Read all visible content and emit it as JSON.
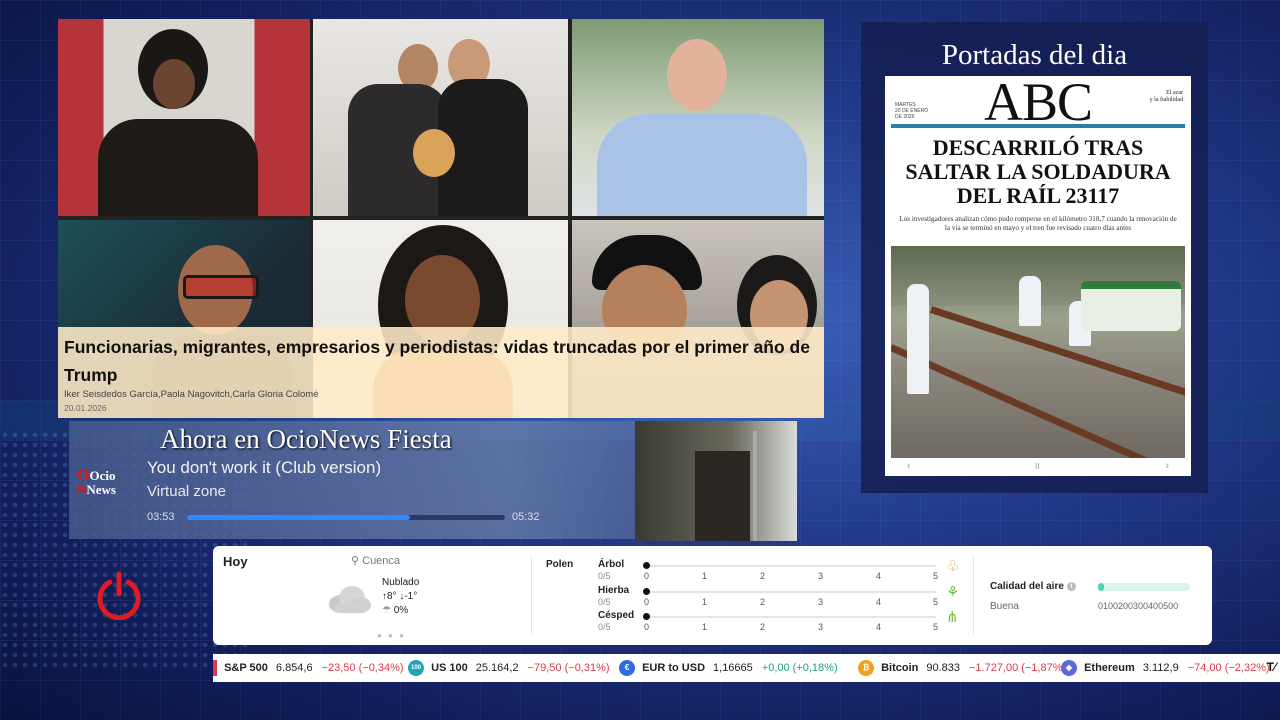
{
  "news": {
    "title": "Funcionarias, migrantes, empresarios y periodistas: vidas truncadas por el primer año de Trump",
    "authors": "Iker Seisdedos García,Paola Nagovitch,Carla Gloria Colomé",
    "date": "20.01.2026"
  },
  "now_playing": {
    "heading": "Ahora en OcioNews Fiesta",
    "song": "You don't work it (Club version)",
    "artist": "Virtual zone",
    "elapsed": "03:53",
    "total": "05:32",
    "progress": 0.7,
    "logo_lines": [
      "Ocio",
      "News"
    ]
  },
  "front_pages": {
    "heading": "Portadas del dia",
    "masthead": "ABC",
    "date_line": [
      "MARTES",
      "20 DE ENERO",
      "DE 2026"
    ],
    "tagline": [
      "El azar",
      "y la fiabilidad"
    ],
    "headline": "DESCARRILÓ TRAS SALTAR LA SOLDADURA DEL RAÍL 23117",
    "subheadline": "Los investigadores analizan cómo pudo romperse en el kilómetro 318,7 cuando la renovación de la vía se terminó en mayo y el tren fue revisado cuatro días antes",
    "prev": "‹",
    "pause": "II",
    "next": "›"
  },
  "weather": {
    "day": "Hoy",
    "location": "Cuenca",
    "condition": "Nublado",
    "temps": "↑8°  ↓-1°",
    "precip": "0%",
    "pager": "● ● ●",
    "pollen_label": "Polen",
    "pollen": [
      {
        "name": "Árbol",
        "value": "0/5",
        "icon": "tree-icon"
      },
      {
        "name": "Hierba",
        "value": "0/5",
        "icon": "herb-icon"
      },
      {
        "name": "Césped",
        "value": "0/5",
        "icon": "grass-icon"
      }
    ],
    "scale": [
      "0",
      "1",
      "2",
      "3",
      "4",
      "5"
    ],
    "air_quality_label": "Calidad del aire",
    "air_quality_value": "Buena",
    "air_scale": "0100200300400500"
  },
  "ticker": [
    {
      "name": "S&P 500",
      "price": "6.854,6",
      "change": "−23,50 (−0,34%)",
      "dir": "down",
      "icon_text": "",
      "color": "#e0394a"
    },
    {
      "name": "US 100",
      "price": "25.164,2",
      "change": "−79,50 (−0,31%)",
      "dir": "down",
      "icon_text": "100",
      "color": "#20a5b8"
    },
    {
      "name": "EUR to USD",
      "price": "1,16665",
      "change": "+0,00 (+0,18%)",
      "dir": "up",
      "icon_text": "€",
      "color": "#2f6be0"
    },
    {
      "name": "Bitcoin",
      "price": "90.833",
      "change": "−1.727,00 (−1,87%)",
      "dir": "down",
      "icon_text": "₿",
      "color": "#f2a01f"
    },
    {
      "name": "Ethereum",
      "price": "3.112,9",
      "change": "−74,00 (−2,32%)",
      "dir": "down",
      "icon_text": "◆",
      "color": "#5b6ad9"
    }
  ],
  "ticker_brand": "T⁄"
}
